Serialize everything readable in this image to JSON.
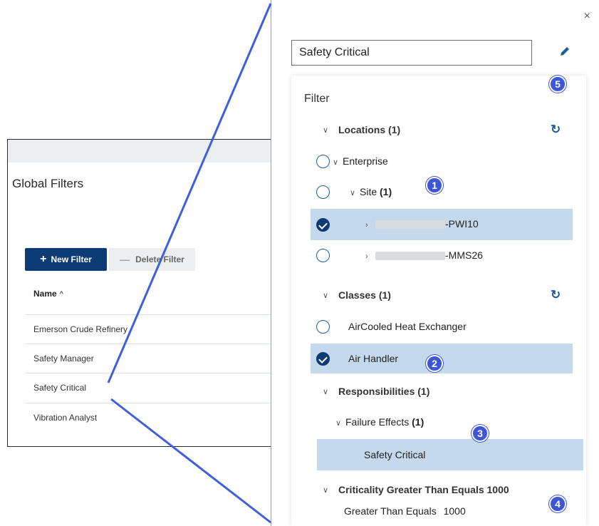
{
  "left": {
    "title": "Global Filters",
    "new_filter_label": "New Filter",
    "delete_filter_label": "Delete Filter",
    "name_column": "Name",
    "rows": [
      "Emerson Crude Refinery",
      "Safety Manager",
      "Safety Critical",
      "Vibration Analyst"
    ]
  },
  "panel": {
    "close_label": "×",
    "name_value": "Safety Critical",
    "filter_title": "Filter",
    "locations": {
      "header": "Locations (1)",
      "enterprise": "Enterprise",
      "site_label": "Site",
      "site_count": "(1)",
      "item1_suffix": "-PWI10",
      "item2_suffix": "-MMS26"
    },
    "classes": {
      "header": "Classes (1)",
      "item1": "AirCooled Heat Exchanger",
      "item2": "Air Handler"
    },
    "responsibilities": {
      "header": "Responsibilities (1)",
      "sub_label": "Failure Effects",
      "sub_count": "(1)",
      "item": "Safety Critical"
    },
    "criticality": {
      "header": "Criticality Greater Than Equals 1000",
      "label": "Greater Than Equals",
      "value": "1000"
    }
  },
  "badges": [
    "1",
    "2",
    "3",
    "4",
    "5"
  ],
  "colors": {
    "primary": "#0d3c74",
    "highlight": "#c5d9ec",
    "badge": "#3d56d8",
    "connector": "#3f5ee0"
  }
}
